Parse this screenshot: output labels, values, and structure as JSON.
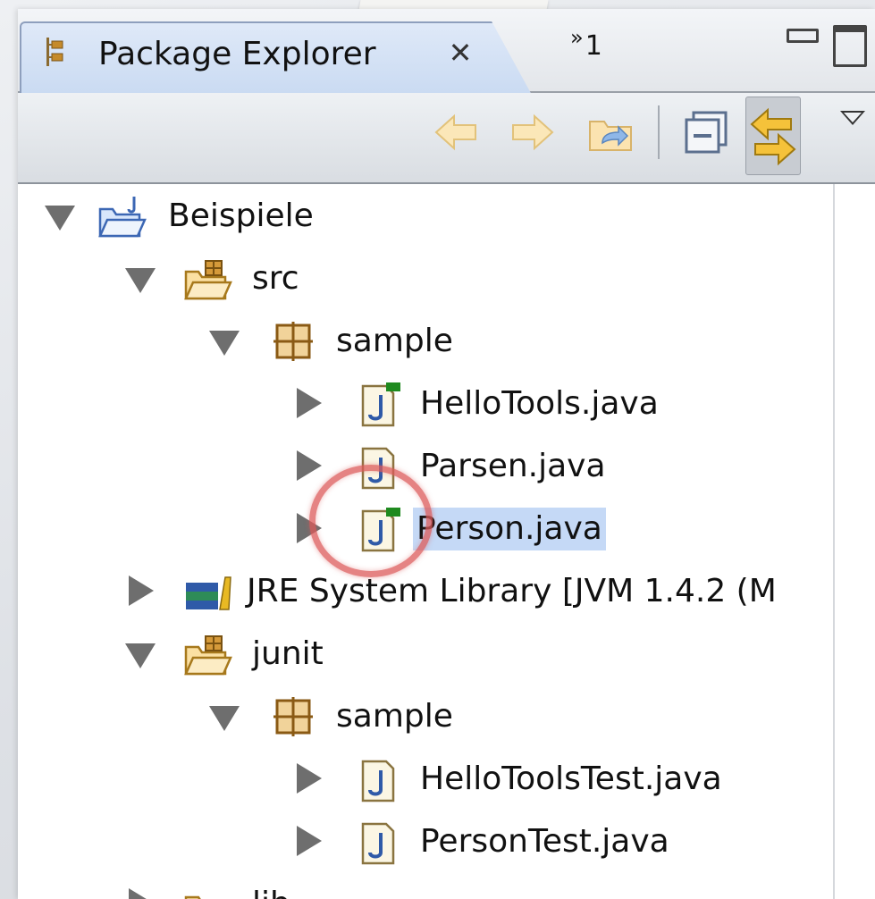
{
  "view": {
    "tab_title": "Package Explorer",
    "overflow_indicator": "»",
    "overflow_count": "1"
  },
  "tree": [
    {
      "label": "Beispiele",
      "icon": "project-folder-icon",
      "state": "expanded",
      "level": 0
    },
    {
      "label": "src",
      "icon": "source-folder-icon",
      "state": "expanded",
      "level": 1
    },
    {
      "label": "sample",
      "icon": "package-icon",
      "state": "expanded",
      "level": 2
    },
    {
      "label": "HelloTools.java",
      "icon": "java-file-icon",
      "state": "collapsed",
      "level": 3,
      "badge": true
    },
    {
      "label": "Parsen.java",
      "icon": "java-file-icon",
      "state": "collapsed",
      "level": 3
    },
    {
      "label": "Person.java",
      "icon": "java-file-icon",
      "state": "collapsed",
      "level": 3,
      "badge": true,
      "selected": true
    },
    {
      "label": "JRE System Library [JVM 1.4.2 (M",
      "icon": "library-icon",
      "state": "collapsed",
      "level": 1
    },
    {
      "label": "junit",
      "icon": "source-folder-icon",
      "state": "expanded",
      "level": 1
    },
    {
      "label": "sample",
      "icon": "package-icon",
      "state": "expanded",
      "level": 2
    },
    {
      "label": "HelloToolsTest.java",
      "icon": "java-file-icon",
      "state": "collapsed",
      "level": 3
    },
    {
      "label": "PersonTest.java",
      "icon": "java-file-icon",
      "state": "collapsed",
      "level": 3
    },
    {
      "label": "lib",
      "icon": "folder-icon",
      "state": "collapsed",
      "level": 1
    }
  ],
  "colors": {
    "selection": "#c5d9f6",
    "highlight_ring": "#dc5a5a",
    "java_badge": "#1f8a1f"
  }
}
